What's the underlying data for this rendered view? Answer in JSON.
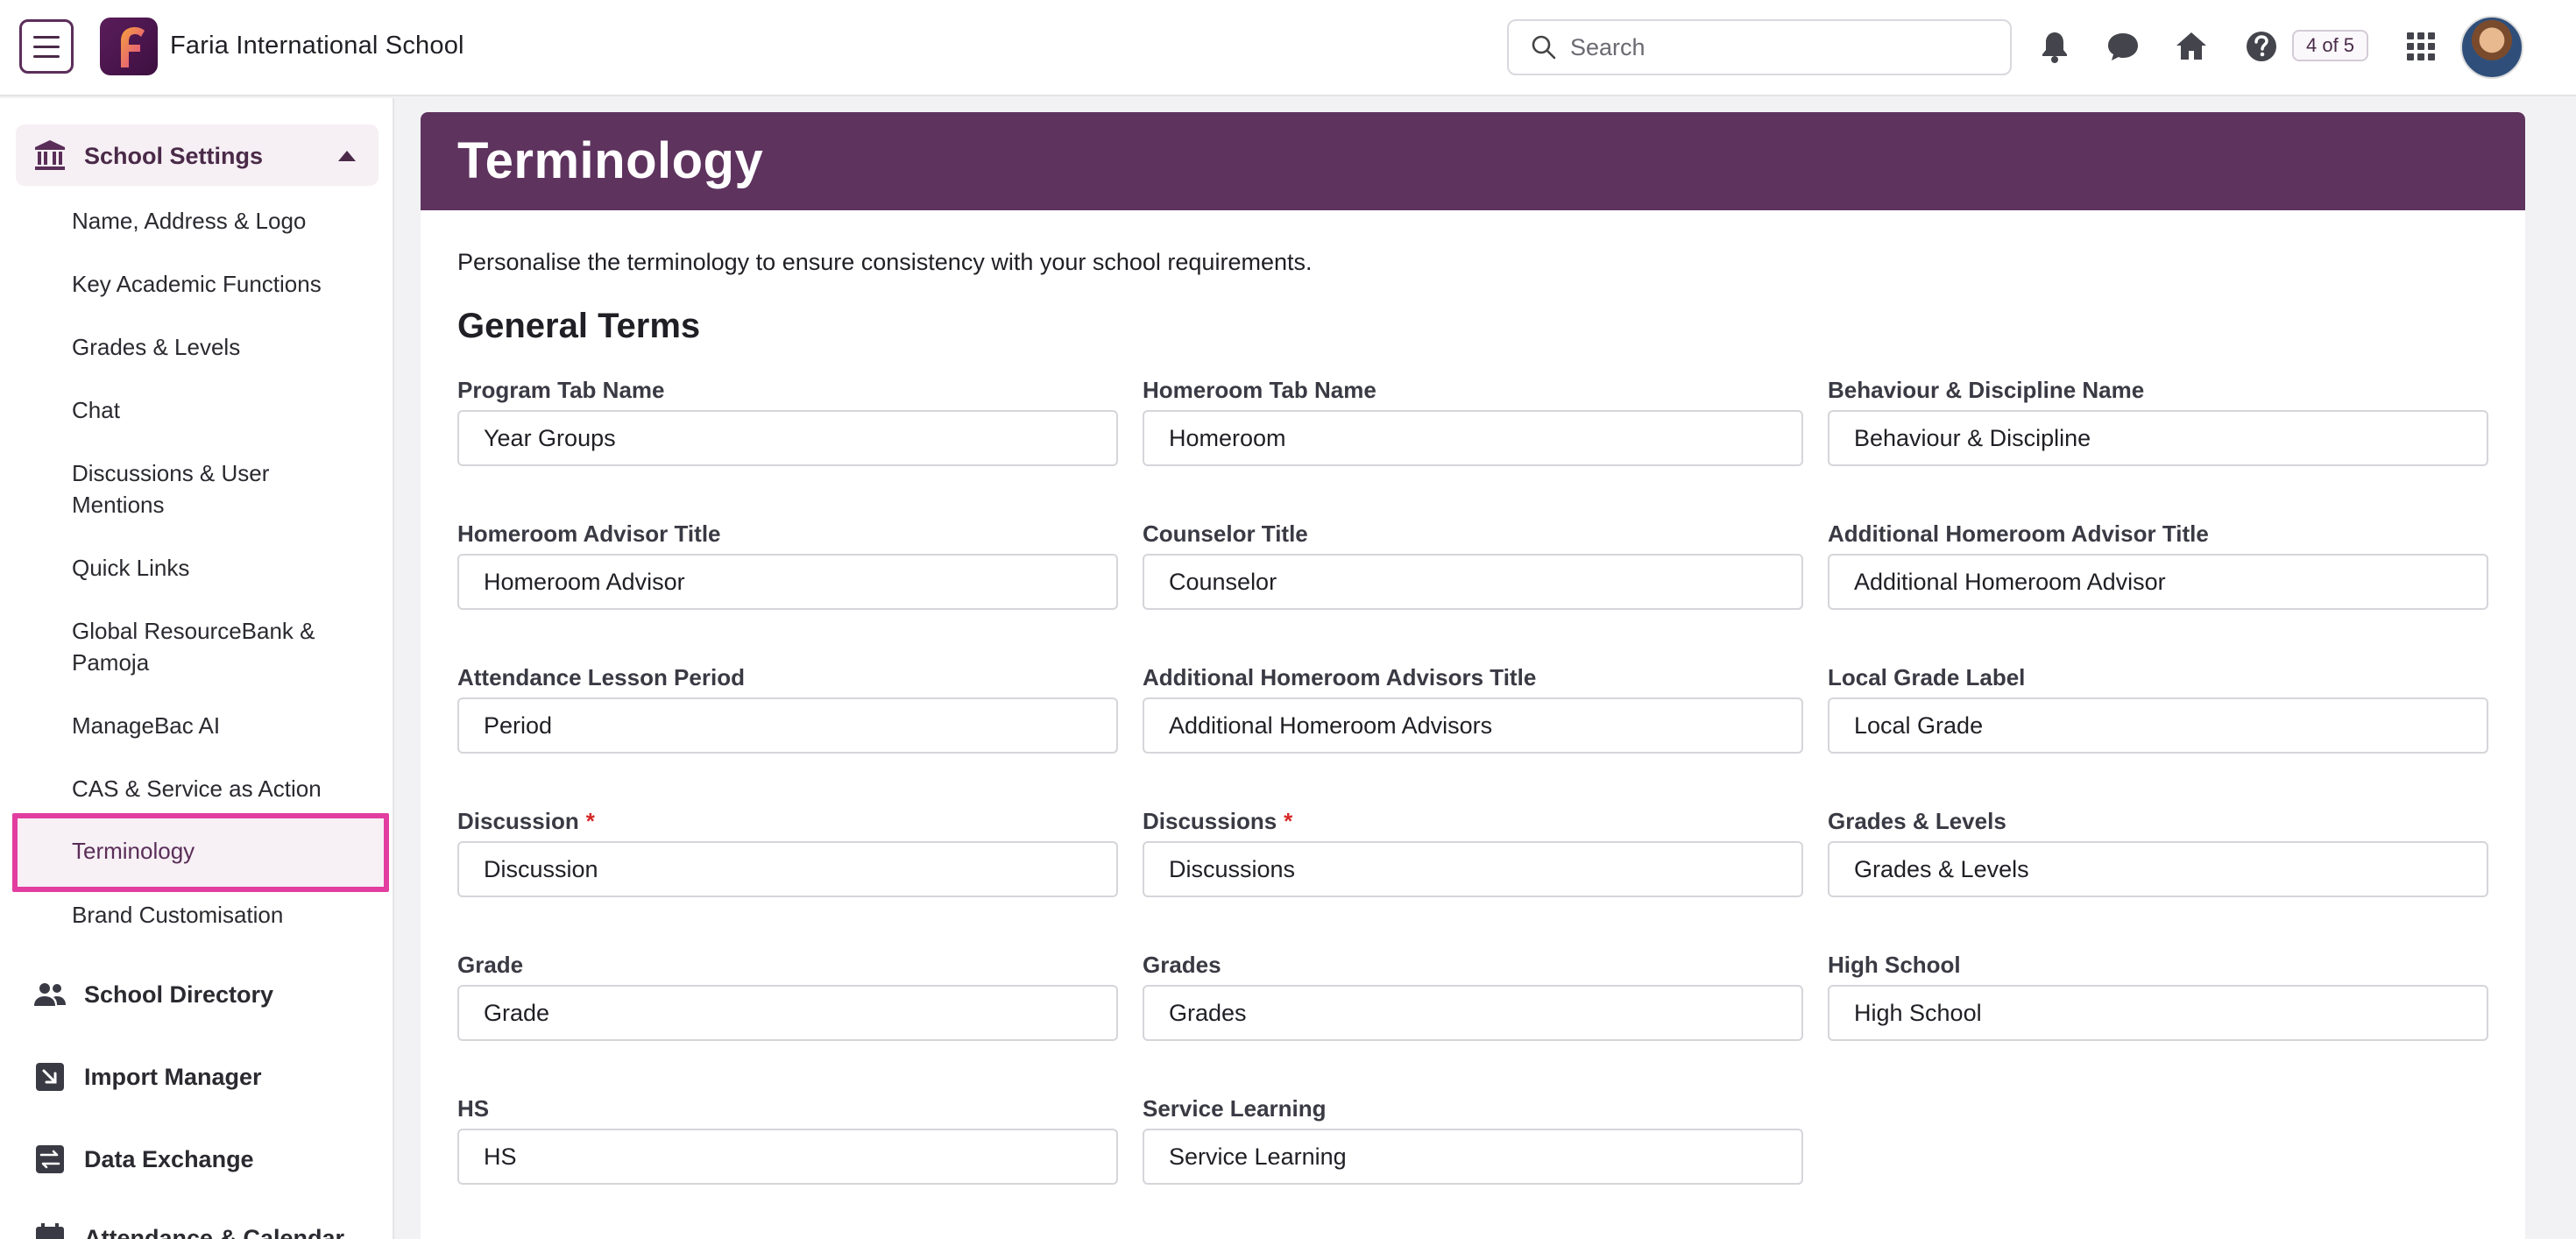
{
  "header": {
    "school_name": "Faria International School",
    "search_placeholder": "Search",
    "counter": "4 of 5",
    "accent": "#5e335e"
  },
  "sidebar": {
    "section": {
      "label": "School Settings",
      "icon": "bank-icon",
      "expanded": true
    },
    "sub_items": [
      "Name, Address & Logo",
      "Key Academic Functions",
      "Grades & Levels",
      "Chat",
      "Discussions & User Mentions",
      "Quick Links",
      "Global ResourceBank & Pamoja",
      "ManageBac AI",
      "CAS & Service as Action",
      "Terminology",
      "Brand Customisation"
    ],
    "active_item": "Terminology",
    "nav_items": [
      {
        "label": "School Directory",
        "icon": "people-icon"
      },
      {
        "label": "Import Manager",
        "icon": "import-icon"
      },
      {
        "label": "Data Exchange",
        "icon": "exchange-icon"
      },
      {
        "label": "Attendance & Calendar",
        "icon": "calendar-icon"
      }
    ]
  },
  "main": {
    "title": "Terminology",
    "description": "Personalise the terminology to ensure consistency with your school requirements.",
    "section_title": "General Terms",
    "fields": [
      {
        "label": "Program Tab Name",
        "value": "Year Groups",
        "required": false
      },
      {
        "label": "Homeroom Tab Name",
        "value": "Homeroom",
        "required": false
      },
      {
        "label": "Behaviour & Discipline Name",
        "value": "Behaviour & Discipline",
        "required": false
      },
      {
        "label": "Homeroom Advisor Title",
        "value": "Homeroom Advisor",
        "required": false
      },
      {
        "label": "Counselor Title",
        "value": "Counselor",
        "required": false
      },
      {
        "label": "Additional Homeroom Advisor Title",
        "value": "Additional Homeroom Advisor",
        "required": false
      },
      {
        "label": "Attendance Lesson Period",
        "value": "Period",
        "required": false
      },
      {
        "label": "Additional Homeroom Advisors Title",
        "value": "Additional Homeroom Advisors",
        "required": false
      },
      {
        "label": "Local Grade Label",
        "value": "Local Grade",
        "required": false
      },
      {
        "label": "Discussion",
        "value": "Discussion",
        "required": true
      },
      {
        "label": "Discussions",
        "value": "Discussions",
        "required": true
      },
      {
        "label": "Grades & Levels",
        "value": "Grades & Levels",
        "required": false
      },
      {
        "label": "Grade",
        "value": "Grade",
        "required": false
      },
      {
        "label": "Grades",
        "value": "Grades",
        "required": false
      },
      {
        "label": "High School",
        "value": "High School",
        "required": false
      },
      {
        "label": "HS",
        "value": "HS",
        "required": false
      },
      {
        "label": "Service Learning",
        "value": "Service Learning",
        "required": false
      }
    ],
    "required_marker": "*"
  }
}
